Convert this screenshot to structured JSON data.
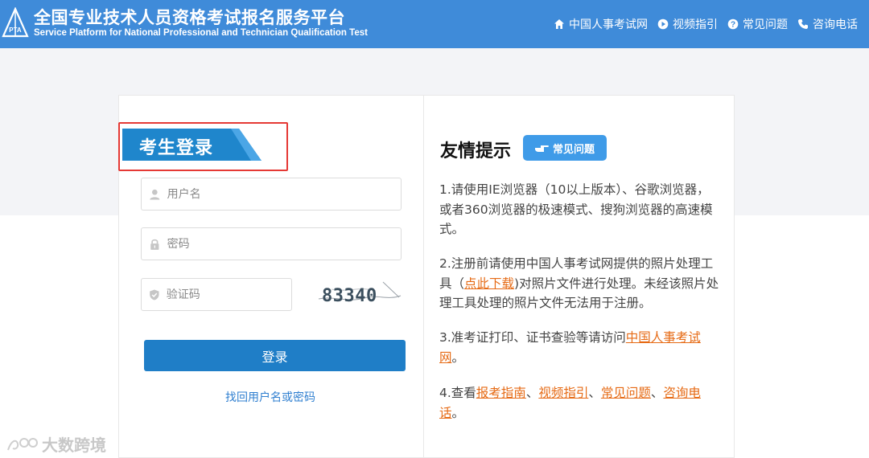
{
  "header": {
    "title_cn": "全国专业技术人员资格考试报名服务平台",
    "title_en": "Service Platform for National Professional and Technician Qualification Test",
    "logo_text": "PTA",
    "nav": [
      {
        "label": "中国人事考试网",
        "icon": "home-icon"
      },
      {
        "label": "视频指引",
        "icon": "play-icon"
      },
      {
        "label": "常见问题",
        "icon": "question-icon"
      },
      {
        "label": "咨询电话",
        "icon": "phone-icon"
      }
    ],
    "bg_color": "#3f8bd9"
  },
  "login": {
    "title": "考生登录",
    "username_placeholder": "用户名",
    "password_placeholder": "密码",
    "captcha_placeholder": "验证码",
    "captcha_text": "83340",
    "submit_label": "登录",
    "forgot_label": "找回用户名或密码",
    "button_color": "#1f7ec7",
    "highlight_color": "#e53935"
  },
  "tips": {
    "title": "友情提示",
    "faq_badge": "常见问题",
    "tip1": "1.请使用IE浏览器（10以上版本）、谷歌浏览器，或者360浏览器的极速模式、搜狗浏览器的高速模式。",
    "tip2_pre": "2.注册前请使用中国人事考试网提供的照片处理工具（",
    "tip2_link": "点此下载",
    "tip2_post": ")对照片文件进行处理。未经该照片处理工具处理的照片文件无法用于注册。",
    "tip3_pre": "3.准考证打印、证书查验等请访问",
    "tip3_link": "中国人事考试网",
    "tip3_post": "。",
    "tip4_pre": "4.查看",
    "tip4_links": [
      "报考指南",
      "视频指引",
      "常见问题",
      "咨询电话"
    ],
    "tip4_sep": "、",
    "tip4_post": "。",
    "link_color": "#e66a14"
  },
  "watermark": "大数跨境"
}
